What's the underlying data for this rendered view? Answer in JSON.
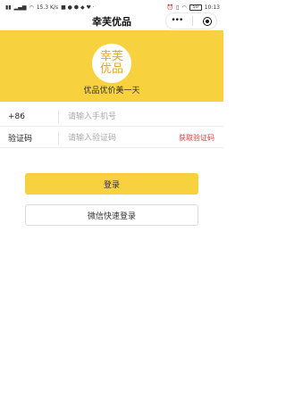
{
  "status_bar": {
    "left_icons": [
      "sim-icon",
      "signal-icon",
      "wifi-icon"
    ],
    "net_speed": "15.3",
    "net_speed_unit": "K/s",
    "time": "10:13",
    "battery": "50"
  },
  "nav": {
    "title": "幸芙优品"
  },
  "header": {
    "logo_line1": "幸芙",
    "logo_line2": "优品",
    "tagline": "优品优价美一天",
    "accent_color": "#f7d23e"
  },
  "form": {
    "phone_label": "+86",
    "phone_placeholder": "请输入手机号",
    "code_label": "验证码",
    "code_placeholder": "请输入验证码",
    "get_code_label": "获取验证码"
  },
  "buttons": {
    "login_label": "登录",
    "wechat_login_label": "微信快速登录"
  }
}
